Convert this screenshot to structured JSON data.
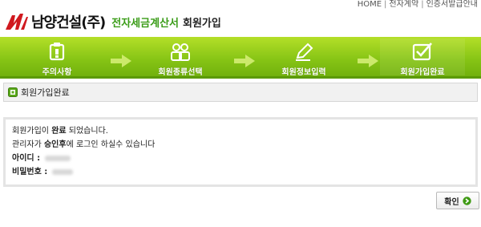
{
  "top_links": {
    "home": "HOME",
    "e_contract": "전자계약",
    "certificate": "인증서발급안내"
  },
  "header": {
    "logo_text": "남양건설(주)",
    "service_title": "전자세금계산서",
    "page_heading": "회원가입"
  },
  "steps": [
    {
      "label": "주의사항",
      "icon": "notice-icon"
    },
    {
      "label": "회원종류선택",
      "icon": "users-icon"
    },
    {
      "label": "회원정보입력",
      "icon": "pencil-icon"
    },
    {
      "label": "회원가입완료",
      "icon": "checkbox-icon"
    }
  ],
  "section": {
    "title": "회원가입완료"
  },
  "message": {
    "line1_prefix": "회원가입이 ",
    "line1_emph": "완료",
    "line1_suffix": " 되었습니다.",
    "line2_prefix": "관리자가 ",
    "line2_emph": "승인후",
    "line2_suffix": "에 로그인 하실수 있습니다",
    "id_label": "아이디 :",
    "password_label": "비밀번호 :"
  },
  "confirm_button": {
    "label": "확인"
  },
  "colors": {
    "accent_green": "#3a9c18",
    "banner_green": "#86c415",
    "logo_red": "#d0191f"
  }
}
